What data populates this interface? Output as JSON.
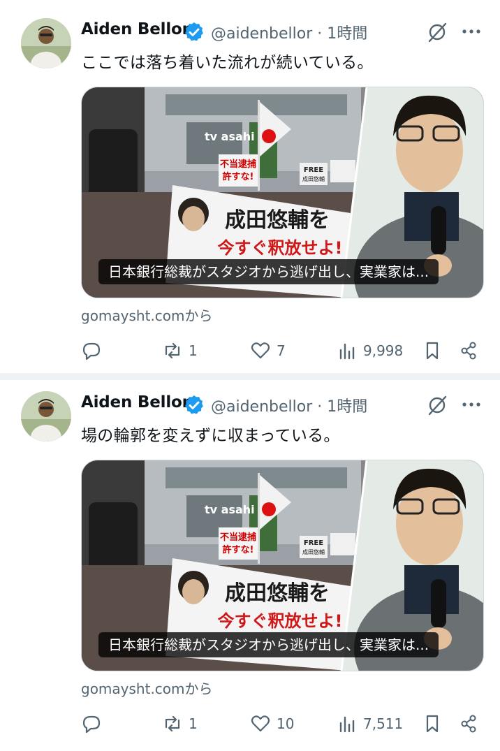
{
  "tweets": [
    {
      "author_name": "Aiden Bellor",
      "handle_time": "@aidenbellor · 1時間",
      "text": "ここでは落ち着いた流れが続いている。",
      "card_caption": "日本銀行総裁がスタジオから逃げ出し、実業家は...",
      "source": "gomaysht.comから",
      "replies": "",
      "retweets": "1",
      "likes": "7",
      "views": "9,998"
    },
    {
      "author_name": "Aiden Bellor",
      "handle_time": "@aidenbellor · 1時間",
      "text": "場の輪郭を変えずに収まっている。",
      "card_caption": "日本銀行総裁がスタジオから逃げ出し、実業家は...",
      "source": "gomaysht.comから",
      "replies": "",
      "retweets": "1",
      "likes": "10",
      "views": "7,511"
    }
  ],
  "card_image_text": {
    "tv_logo": "tv asahi",
    "sign_left_1": "不当逮捕",
    "sign_left_2": "許すな!",
    "sign_free_1": "FREE",
    "sign_free_2": "成田悠輔",
    "banner_line1": "成田悠輔を",
    "banner_line2": "今すぐ釈放せよ!"
  },
  "colors": {
    "verified": "#1d9bf0",
    "muted": "#536471",
    "separator": "#eef1f3"
  },
  "icons": [
    "verified-badge-icon",
    "grok-icon",
    "more-icon",
    "reply-icon",
    "retweet-icon",
    "like-icon",
    "views-icon",
    "bookmark-icon",
    "share-icon"
  ]
}
